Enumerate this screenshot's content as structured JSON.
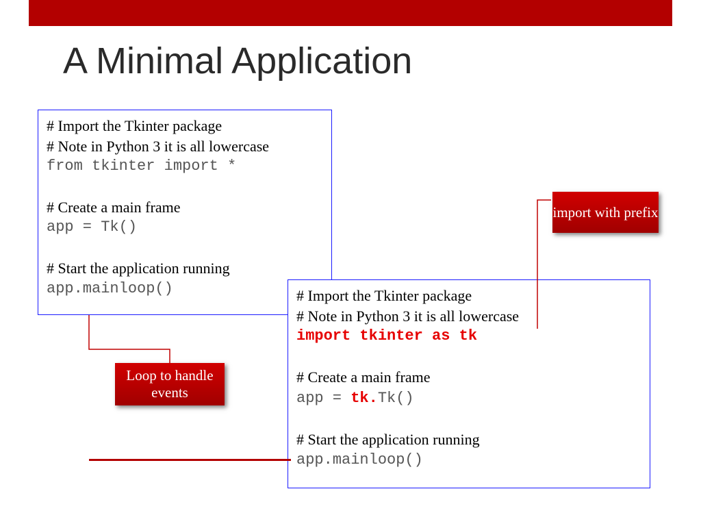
{
  "title": "A Minimal Application",
  "code1": {
    "c1": "#   Import the Tkinter package",
    "c2": "#        Note in Python 3 it is all lowercase",
    "l1": "from tkinter import *",
    "c3": "#   Create a main frame",
    "l2": "app = Tk()",
    "c4": "#   Start the application running",
    "l3": "app.mainloop()"
  },
  "code2": {
    "c1": "#   Import the Tkinter package",
    "c2": "#        Note in Python 3 it is all lowercase",
    "l1": "import tkinter as tk",
    "c3": "#   Create a main frame",
    "l2a": "app = ",
    "l2b": "tk.",
    "l2c": "Tk()",
    "c4": "#   Start the application running",
    "l3": "app.mainloop()"
  },
  "callouts": {
    "loop": "Loop to handle events",
    "import": "import with prefix"
  }
}
